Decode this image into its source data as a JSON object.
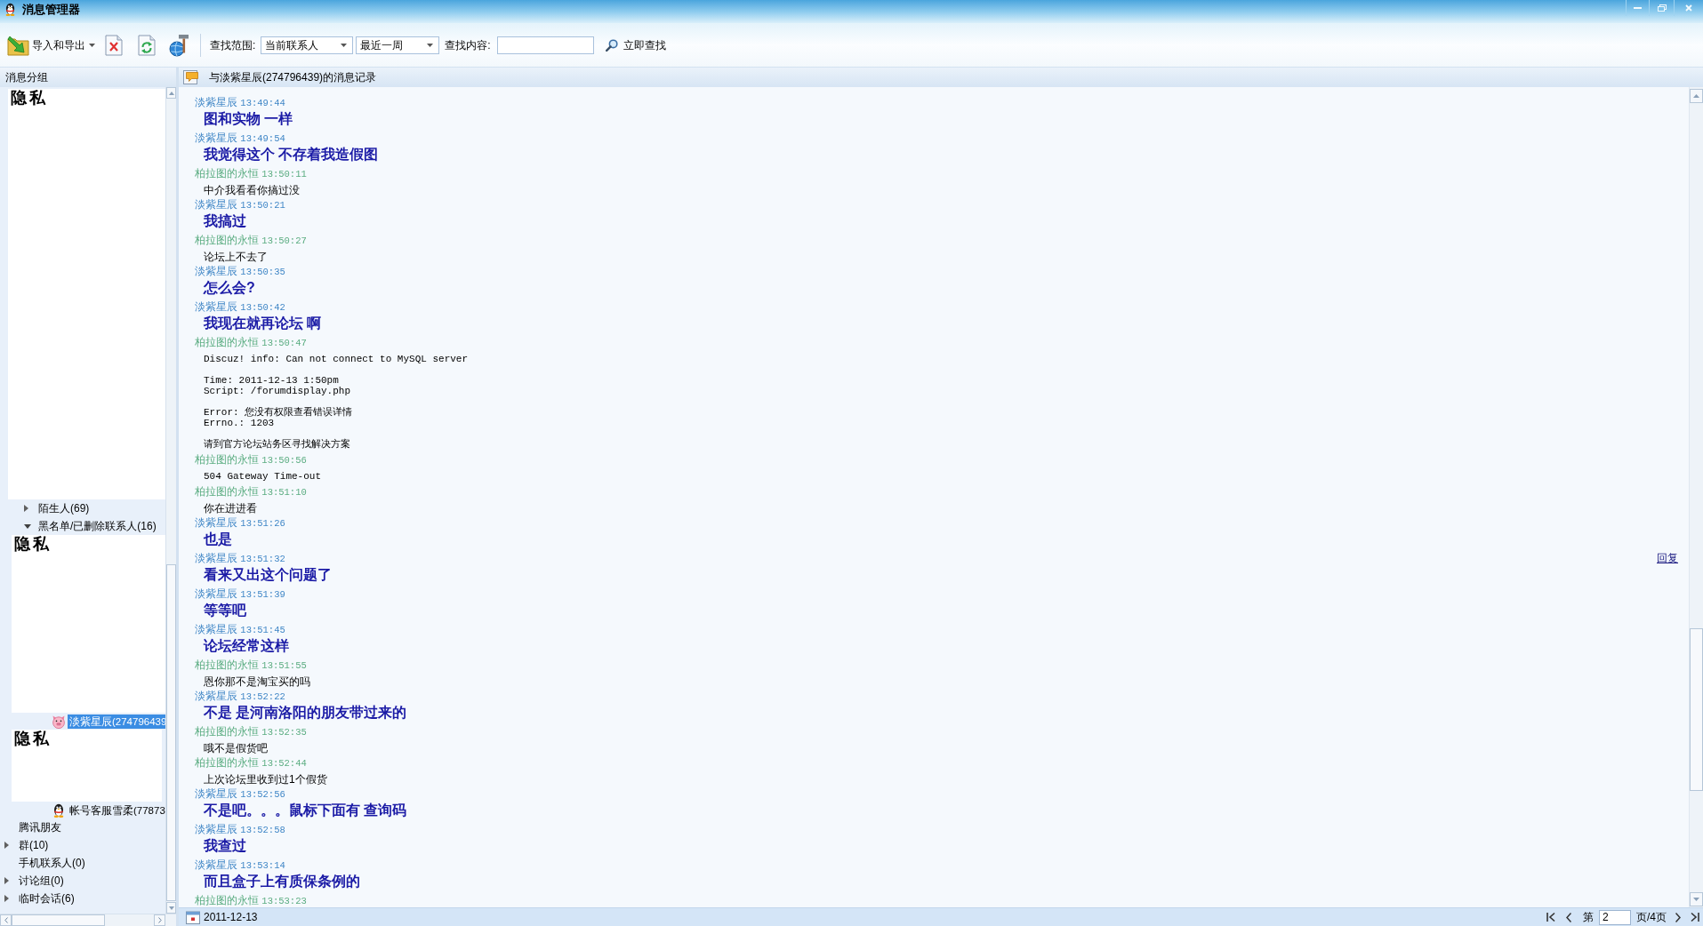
{
  "window": {
    "title": "消息管理器"
  },
  "toolbar": {
    "import_export": "导入和导出",
    "scope_label": "查找范围:",
    "scope": "当前联系人",
    "period": "最近一周",
    "content_label": "查找内容:",
    "search_button": "立即查找"
  },
  "sidebar": {
    "title": "消息分组",
    "tree": [
      {
        "kind": "redacted",
        "label": "隐私",
        "children": [
          {
            "kind": "group",
            "label": "陌生人(69)",
            "expanded": false
          },
          {
            "kind": "group",
            "label": "黑名单/已删除联系人(16)",
            "expanded": true,
            "children": [
              {
                "kind": "redacted",
                "label": "隐私"
              },
              {
                "kind": "contact",
                "label": "淡紫星辰(274796439",
                "selected": true
              },
              {
                "kind": "redacted",
                "label": "隐私"
              },
              {
                "kind": "contact",
                "label": "帐号客服雪柔(77873",
                "selected": false
              }
            ]
          }
        ]
      },
      {
        "kind": "plain",
        "label": "腾讯朋友"
      },
      {
        "kind": "group",
        "label": "群(10)",
        "expanded": false
      },
      {
        "kind": "plain",
        "label": "手机联系人(0)"
      },
      {
        "kind": "group",
        "label": "讨论组(0)",
        "expanded": false
      },
      {
        "kind": "group",
        "label": "临时会话(6)",
        "expanded": false
      }
    ]
  },
  "chat": {
    "title": "与淡紫星辰(274796439)的消息记录",
    "messages": [
      {
        "sender": "淡紫星辰",
        "time": "13:49:44",
        "color": "#3f86c6",
        "kind": "bold",
        "text": "图和实物 一样"
      },
      {
        "sender": "淡紫星辰",
        "time": "13:49:54",
        "color": "#3f86c6",
        "kind": "bold",
        "text": "我觉得这个 不存着我造假图"
      },
      {
        "sender": "柏拉图的永恒",
        "time": "13:50:11",
        "color": "#5aac80",
        "kind": "plain",
        "text": "中介我看看你搞过没"
      },
      {
        "sender": "淡紫星辰",
        "time": "13:50:21",
        "color": "#3f86c6",
        "kind": "bold",
        "text": "我搞过"
      },
      {
        "sender": "柏拉图的永恒",
        "time": "13:50:27",
        "color": "#5aac80",
        "kind": "plain",
        "text": "论坛上不去了"
      },
      {
        "sender": "淡紫星辰",
        "time": "13:50:35",
        "color": "#3f86c6",
        "kind": "bold",
        "text": "怎么会?"
      },
      {
        "sender": "淡紫星辰",
        "time": "13:50:42",
        "color": "#3f86c6",
        "kind": "bold",
        "text": "我现在就再论坛 啊"
      },
      {
        "sender": "柏拉图的永恒",
        "time": "13:50:47",
        "color": "#5aac80",
        "kind": "code",
        "paragraphs": [
          [
            "Discuz! info: Can not connect to MySQL server"
          ],
          [
            "Time: 2011-12-13 1:50pm",
            "Script: /forumdisplay.php"
          ],
          [
            "Error: 您没有权限查看错误详情",
            "Errno.: 1203"
          ],
          [
            "请到官方论坛站务区寻找解决方案"
          ]
        ]
      },
      {
        "sender": "柏拉图的永恒",
        "time": "13:50:56",
        "color": "#5aac80",
        "kind": "code",
        "paragraphs": [
          [
            "504 Gateway Time-out"
          ]
        ]
      },
      {
        "sender": "柏拉图的永恒",
        "time": "13:51:10",
        "color": "#5aac80",
        "kind": "plain",
        "text": "你在进进看"
      },
      {
        "sender": "淡紫星辰",
        "time": "13:51:26",
        "color": "#3f86c6",
        "kind": "bold",
        "text": "也是"
      },
      {
        "sender": "淡紫星辰",
        "time": "13:51:32",
        "color": "#3f86c6",
        "kind": "bold",
        "text": "看来又出这个问题了",
        "reply": "回复"
      },
      {
        "sender": "淡紫星辰",
        "time": "13:51:39",
        "color": "#3f86c6",
        "kind": "bold",
        "text": "等等吧"
      },
      {
        "sender": "淡紫星辰",
        "time": "13:51:45",
        "color": "#3f86c6",
        "kind": "bold",
        "text": "论坛经常这样"
      },
      {
        "sender": "柏拉图的永恒",
        "time": "13:51:55",
        "color": "#5aac80",
        "kind": "plain",
        "text": "恩你那不是淘宝买的吗"
      },
      {
        "sender": "淡紫星辰",
        "time": "13:52:22",
        "color": "#3f86c6",
        "kind": "bold",
        "text": "不是 是河南洛阳的朋友带过来的"
      },
      {
        "sender": "柏拉图的永恒",
        "time": "13:52:35",
        "color": "#5aac80",
        "kind": "plain",
        "text": "哦不是假货吧"
      },
      {
        "sender": "柏拉图的永恒",
        "time": "13:52:44",
        "color": "#5aac80",
        "kind": "plain",
        "text": "上次论坛里收到过1个假货"
      },
      {
        "sender": "淡紫星辰",
        "time": "13:52:56",
        "color": "#3f86c6",
        "kind": "bold",
        "text": "不是吧。。。鼠标下面有 查询码"
      },
      {
        "sender": "淡紫星辰",
        "time": "13:52:58",
        "color": "#3f86c6",
        "kind": "bold",
        "text": "我查过"
      },
      {
        "sender": "淡紫星辰",
        "time": "13:53:14",
        "color": "#3f86c6",
        "kind": "bold",
        "text": "而且盒子上有质保条例的"
      },
      {
        "sender": "柏拉图的永恒",
        "time": "13:53:23",
        "color": "#5aac80"
      }
    ]
  },
  "status_bar": {
    "date": "2011-12-13",
    "page_prefix": "第",
    "page": "2",
    "page_suffix": "页/4页"
  }
}
